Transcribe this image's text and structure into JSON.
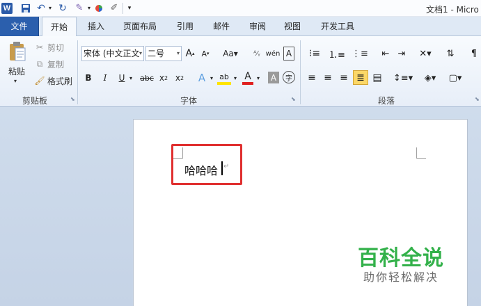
{
  "window": {
    "title": "文档1 - Micro"
  },
  "tabs": {
    "file": "文件",
    "home": "开始",
    "insert": "插入",
    "page_layout": "页面布局",
    "references": "引用",
    "mailings": "邮件",
    "review": "审阅",
    "view": "视图",
    "developer": "开发工具"
  },
  "clipboard": {
    "paste": "粘贴",
    "cut": "剪切",
    "copy": "复制",
    "format_painter": "格式刷",
    "group_label": "剪贴板"
  },
  "font": {
    "name": "宋体 (中文正文",
    "size": "二号",
    "group_label": "字体"
  },
  "paragraph": {
    "group_label": "段落"
  },
  "document": {
    "text": "哈哈哈"
  },
  "watermark": {
    "title": "百科全说",
    "subtitle": "助你轻松解决"
  },
  "colors": {
    "accent": "#2b5fad",
    "highlight_box": "#e03030",
    "watermark": "#33b14a"
  }
}
